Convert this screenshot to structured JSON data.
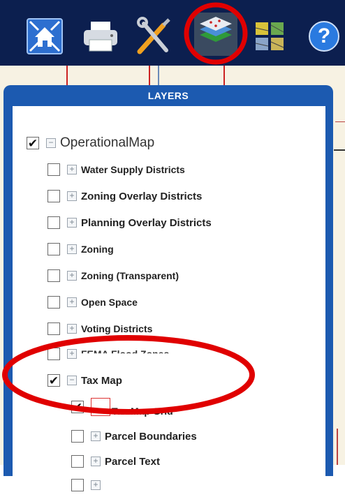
{
  "toolbar": {
    "tools": [
      {
        "name": "home-extent-icon"
      },
      {
        "name": "print-icon"
      },
      {
        "name": "tools-icon"
      },
      {
        "name": "layers-icon"
      },
      {
        "name": "basemap-gallery-icon"
      },
      {
        "name": "help-icon",
        "glyph": "?"
      }
    ]
  },
  "layers": {
    "title": "LAYERS",
    "root": {
      "label": "OperationalMap",
      "checked": true,
      "expander": "−"
    },
    "items": [
      {
        "label": "Water Supply Districts",
        "checked": false,
        "expander": "+"
      },
      {
        "label": "Zoning Overlay Districts",
        "checked": false,
        "expander": "+"
      },
      {
        "label": "Planning Overlay Districts",
        "checked": false,
        "expander": "+"
      },
      {
        "label": "Zoning",
        "checked": false,
        "expander": "+"
      },
      {
        "label": "Zoning (Transparent)",
        "checked": false,
        "expander": "+"
      },
      {
        "label": "Open Space",
        "checked": false,
        "expander": "+"
      },
      {
        "label": "Voting Districts",
        "checked": false,
        "expander": "+"
      },
      {
        "label": "FEMA Flood Zones",
        "checked": false,
        "expander": "+"
      },
      {
        "label": "Tax Map",
        "checked": true,
        "expander": "−"
      }
    ],
    "taxmap_children": [
      {
        "label": "Tax Map Grid",
        "checked": true
      },
      {
        "label": "Parcel Boundaries",
        "checked": false,
        "expander": "+"
      },
      {
        "label": "Parcel Text",
        "checked": false,
        "expander": "+"
      },
      {
        "label": "",
        "checked": false,
        "expander": "+"
      }
    ]
  },
  "highlight_color": "#e00000",
  "checkmark": "✔"
}
